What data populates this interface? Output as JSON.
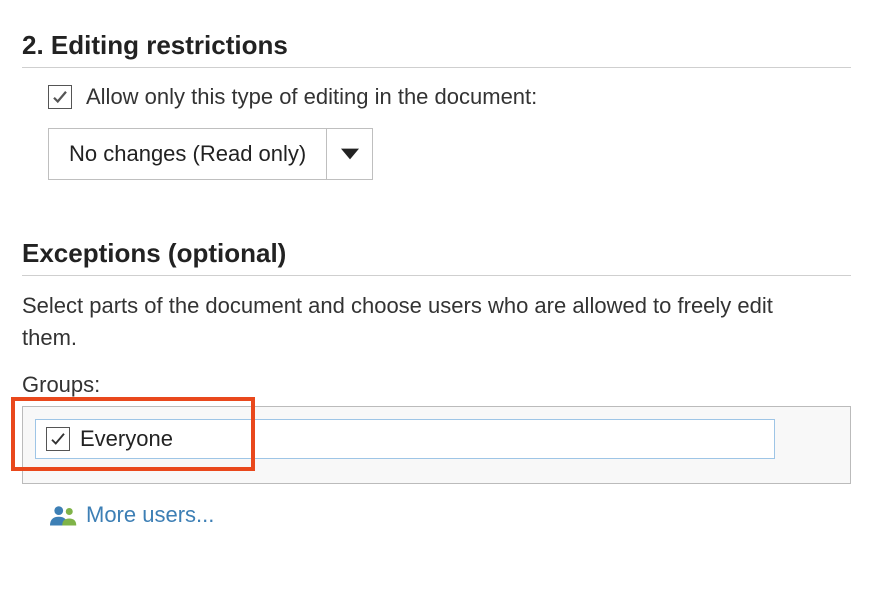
{
  "editing": {
    "title": "2. Editing restrictions",
    "checkbox_checked": true,
    "allow_label": "Allow only this type of editing in the document:",
    "dropdown_value": "No changes (Read only)"
  },
  "exceptions": {
    "title": "Exceptions (optional)",
    "description": "Select parts of the document and choose users who are allowed to freely edit them.",
    "groups_label": "Groups:",
    "items": [
      {
        "checked": true,
        "label": "Everyone"
      }
    ],
    "more_users_label": "More users..."
  }
}
